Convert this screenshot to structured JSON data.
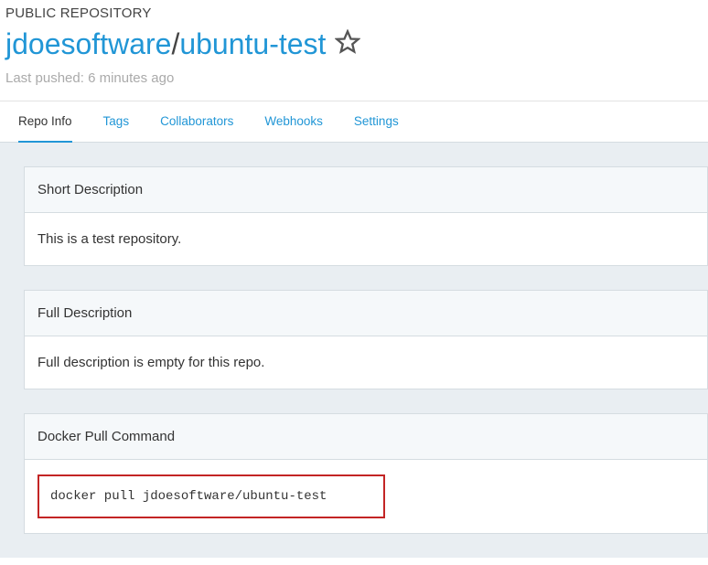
{
  "header": {
    "repo_type": "PUBLIC REPOSITORY",
    "owner": "jdoesoftware",
    "slash": "/",
    "name": "ubuntu-test",
    "last_pushed": "Last pushed: 6 minutes ago"
  },
  "tabs": {
    "repo_info": "Repo Info",
    "tags": "Tags",
    "collaborators": "Collaborators",
    "webhooks": "Webhooks",
    "settings": "Settings"
  },
  "panels": {
    "short_desc_header": "Short Description",
    "short_desc_body": "This is a test repository.",
    "full_desc_header": "Full Description",
    "full_desc_body": "Full description is empty for this repo.",
    "pull_cmd_header": "Docker Pull Command",
    "pull_cmd": "docker pull jdoesoftware/ubuntu-test"
  }
}
